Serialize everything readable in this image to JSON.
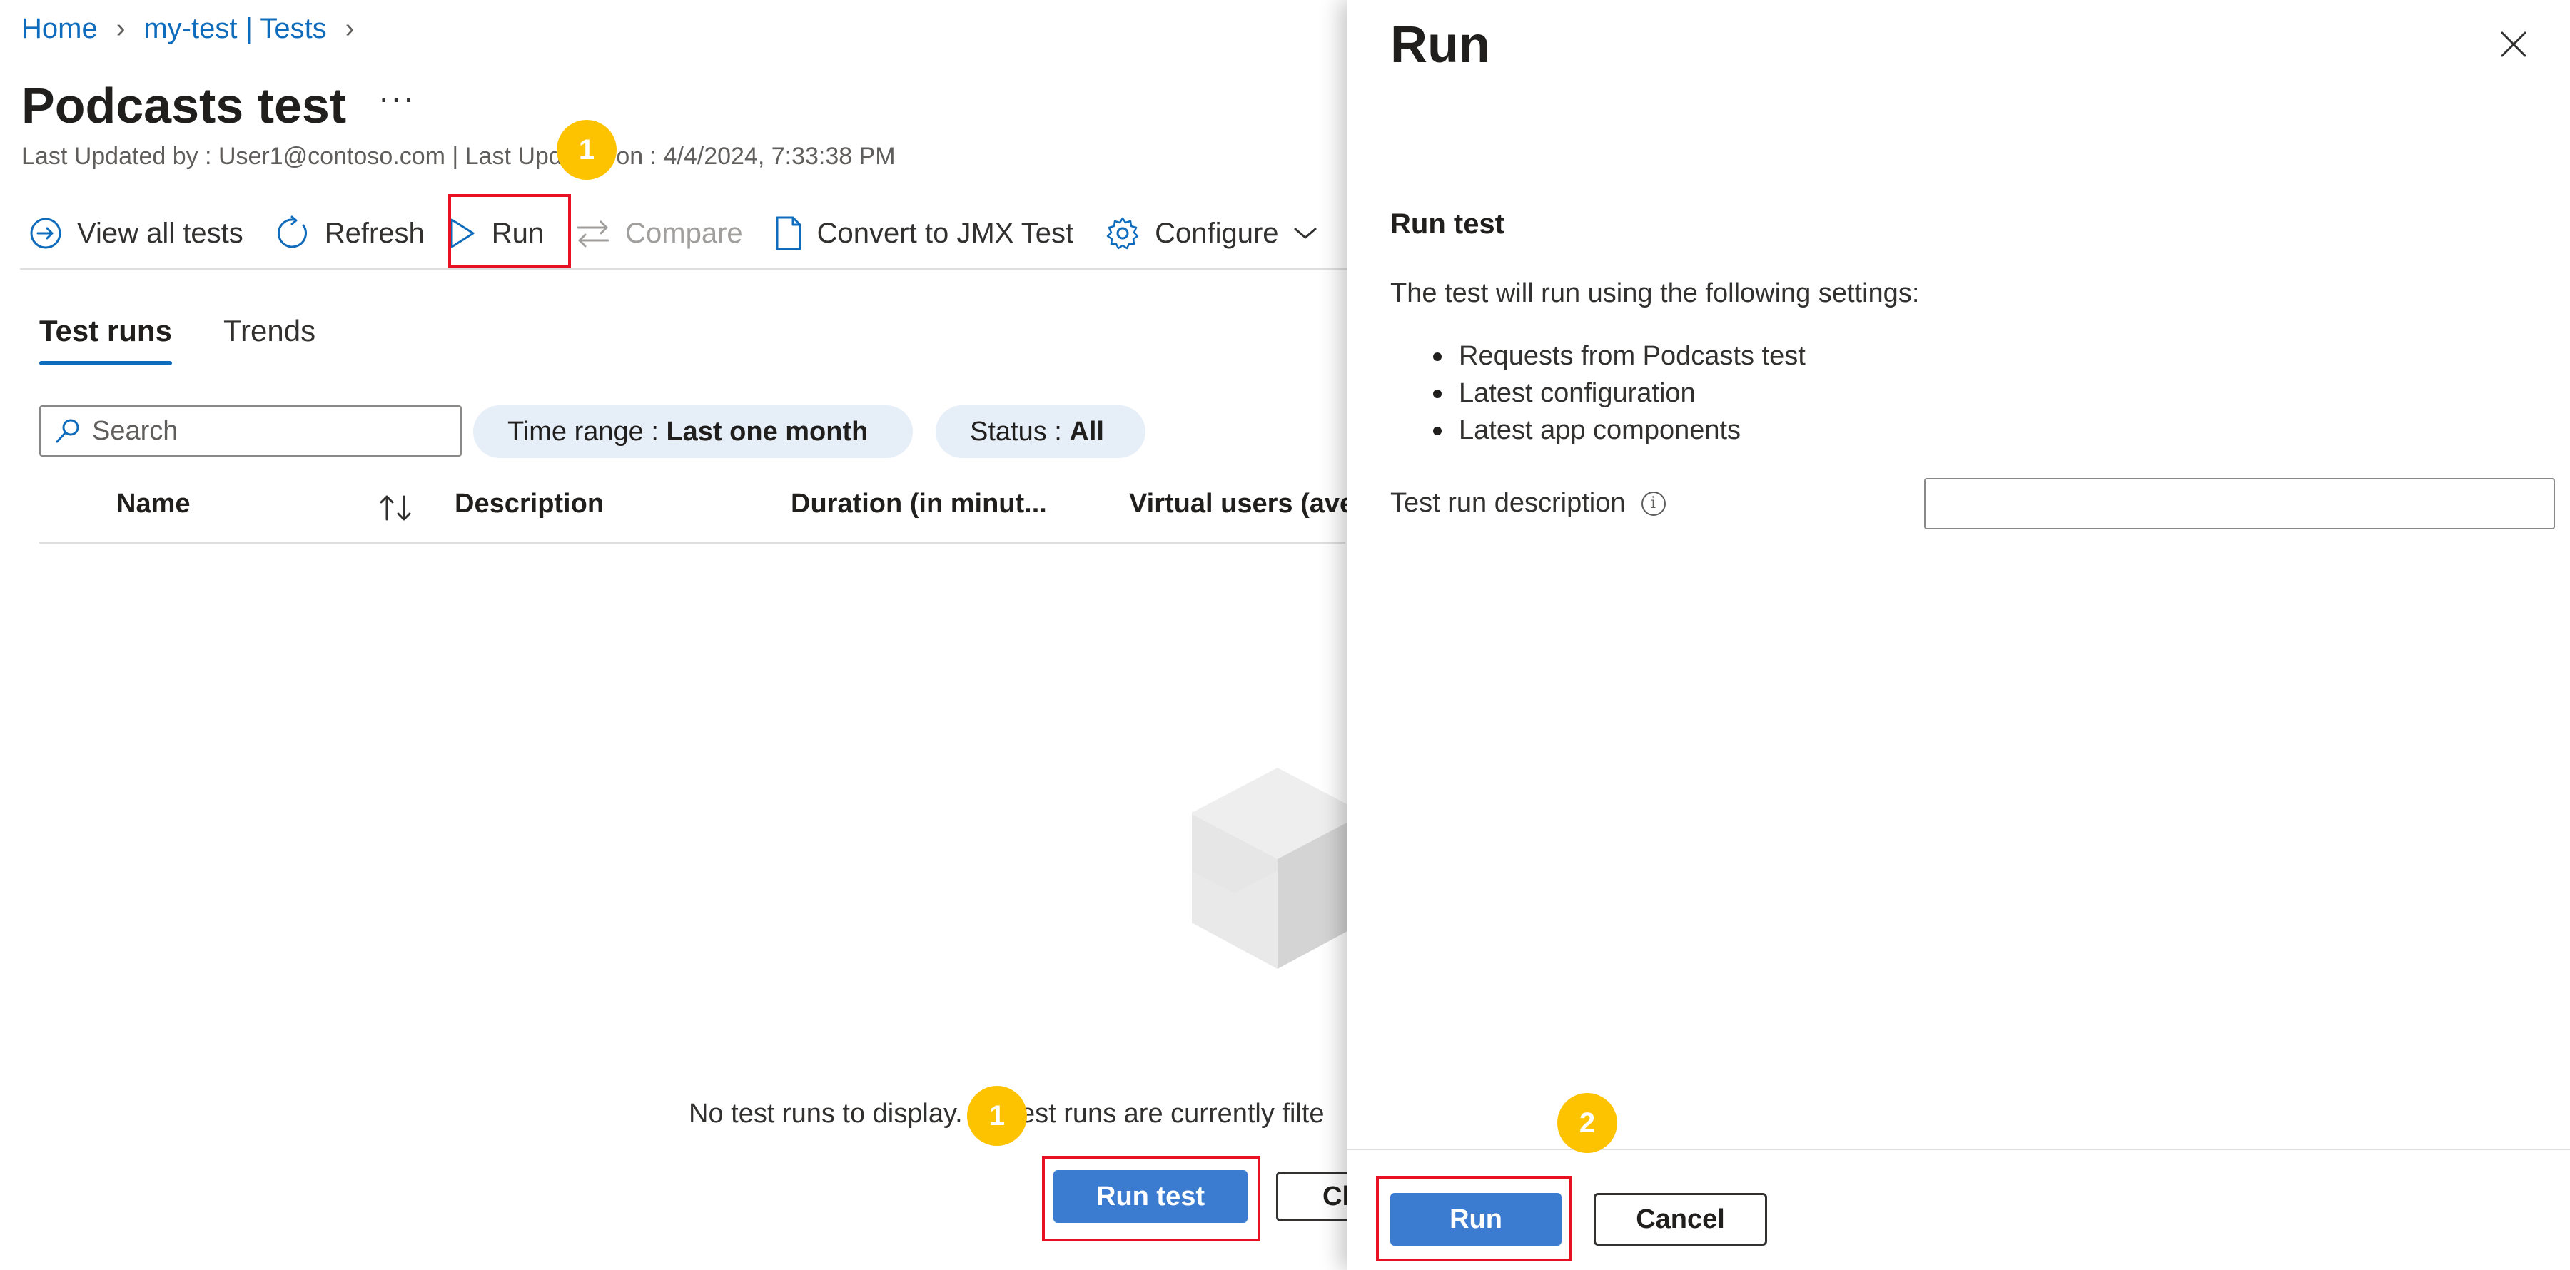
{
  "breadcrumb": {
    "items": [
      "Home",
      "my-test | Tests"
    ]
  },
  "header": {
    "title": "Podcasts test",
    "more_label": "···",
    "subtitle": "Last Updated by : User1@contoso.com | Last Updated on : 4/4/2024, 7:33:38 PM"
  },
  "toolbar": {
    "view_all": "View all tests",
    "refresh": "Refresh",
    "run": "Run",
    "compare": "Compare",
    "convert": "Convert to JMX Test",
    "configure": "Configure"
  },
  "tabs": [
    "Test runs",
    "Trends"
  ],
  "filters": {
    "search_placeholder": "Search",
    "time_range_label": "Time range : ",
    "time_range_value": "Last one month",
    "status_label": "Status : ",
    "status_value": "All"
  },
  "grid": {
    "columns": [
      "Name",
      "Description",
      "Duration (in minut...",
      "Virtual users (ave"
    ]
  },
  "empty_state": {
    "message": "No test runs to display. No test runs are currently filte",
    "run_test_label": "Run test",
    "clear_label": "Cl"
  },
  "callouts": {
    "step1": "1",
    "step2": "2"
  },
  "panel": {
    "title": "Run",
    "section_title": "Run test",
    "intro": "The test will run using the following settings:",
    "bullets": [
      "Requests from Podcasts test",
      "Latest configuration",
      "Latest app components"
    ],
    "description_label": "Test run description",
    "info_label": "i",
    "description_value": "",
    "run_label": "Run",
    "cancel_label": "Cancel"
  },
  "colors": {
    "accent": "#0f6cbd",
    "primary_button": "#3b7bd0",
    "highlight_box": "#e81123",
    "callout": "#fdc300",
    "pill_background": "#e6eef8"
  }
}
